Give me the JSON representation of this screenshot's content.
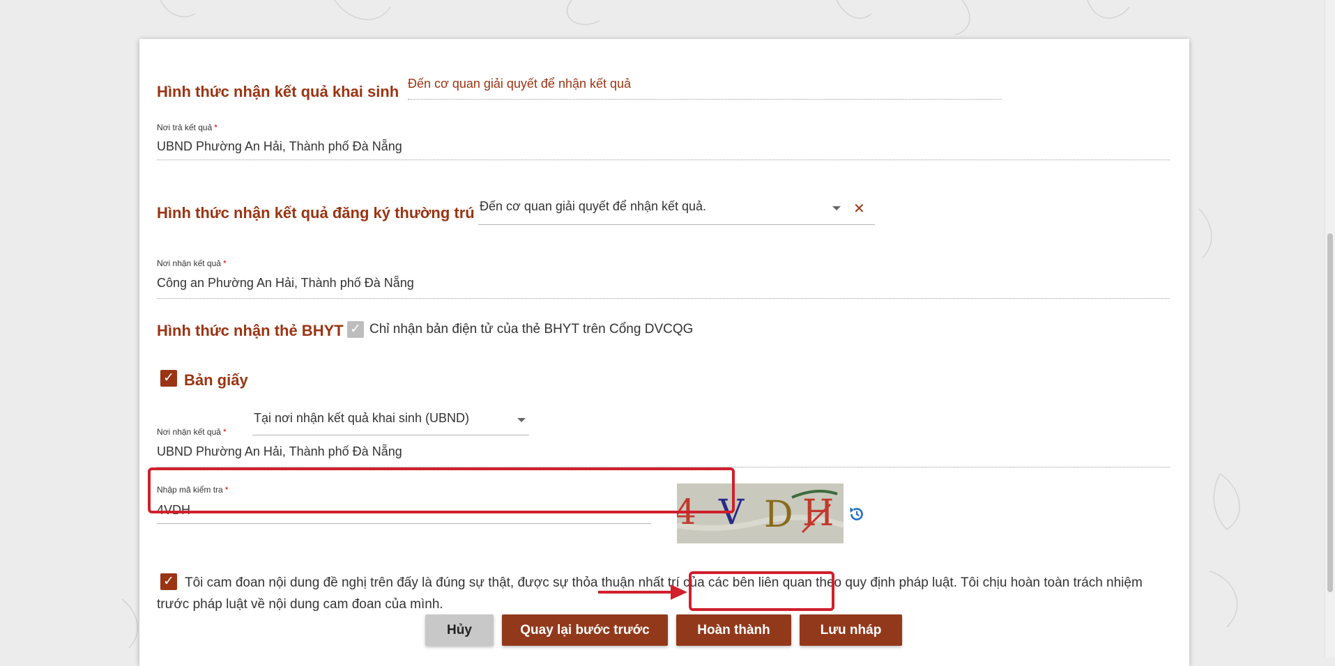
{
  "colors": {
    "accent": "#9a3412",
    "button": "#93391b",
    "annotation": "#d0202c"
  },
  "birth_result": {
    "title": "Hình thức nhận kết quả khai sinh",
    "method_value": "Đến cơ quan giải quyết để nhận kết quả",
    "place_label": "Nơi trả kết quả",
    "place_value": "UBND Phường An Hải, Thành phố Đà Nẵng"
  },
  "residence_result": {
    "title": "Hình thức nhận kết quả đăng ký thường trú",
    "select_value": "Đến cơ quan giải quyết để nhận kết quả.",
    "clear_icon": "close-icon",
    "place_label": "Nơi nhận kết quả",
    "place_value": "Công an Phường An Hải, Thành phố Đà Nẵng"
  },
  "bhyt": {
    "title": "Hình thức nhận thẻ BHYT",
    "electronic_checked": true,
    "electronic_label": "Chỉ nhận bản điện tử của thẻ BHYT trên Cổng DVCQG",
    "paper_checked": true,
    "paper_label": "Bản giấy",
    "paper_select_value": "Tại nơi nhận kết quả khai sinh (UBND)",
    "place_label": "Nơi nhận kết quả",
    "place_value": "UBND Phường An Hải, Thành phố Đà Nẵng"
  },
  "captcha": {
    "label": "Nhập mã kiểm tra",
    "value": "4VDH",
    "image_chars": [
      "4",
      "V",
      "D",
      "H"
    ],
    "refresh_icon": "refresh-icon"
  },
  "required_mark": "*",
  "check_mark": "✓",
  "commitment": {
    "checked": true,
    "text": "Tôi cam đoan nội dung đề nghị trên đấy là đúng sự thật, được sự thỏa thuận nhất trí của các bên liên quan theo quy định pháp luật. Tôi chịu hoàn toàn trách nhiệm trước pháp luật về nội dung cam đoan của mình."
  },
  "buttons": {
    "cancel": "Hủy",
    "back": "Quay lại bước trước",
    "finish": "Hoàn thành",
    "draft": "Lưu nháp"
  }
}
